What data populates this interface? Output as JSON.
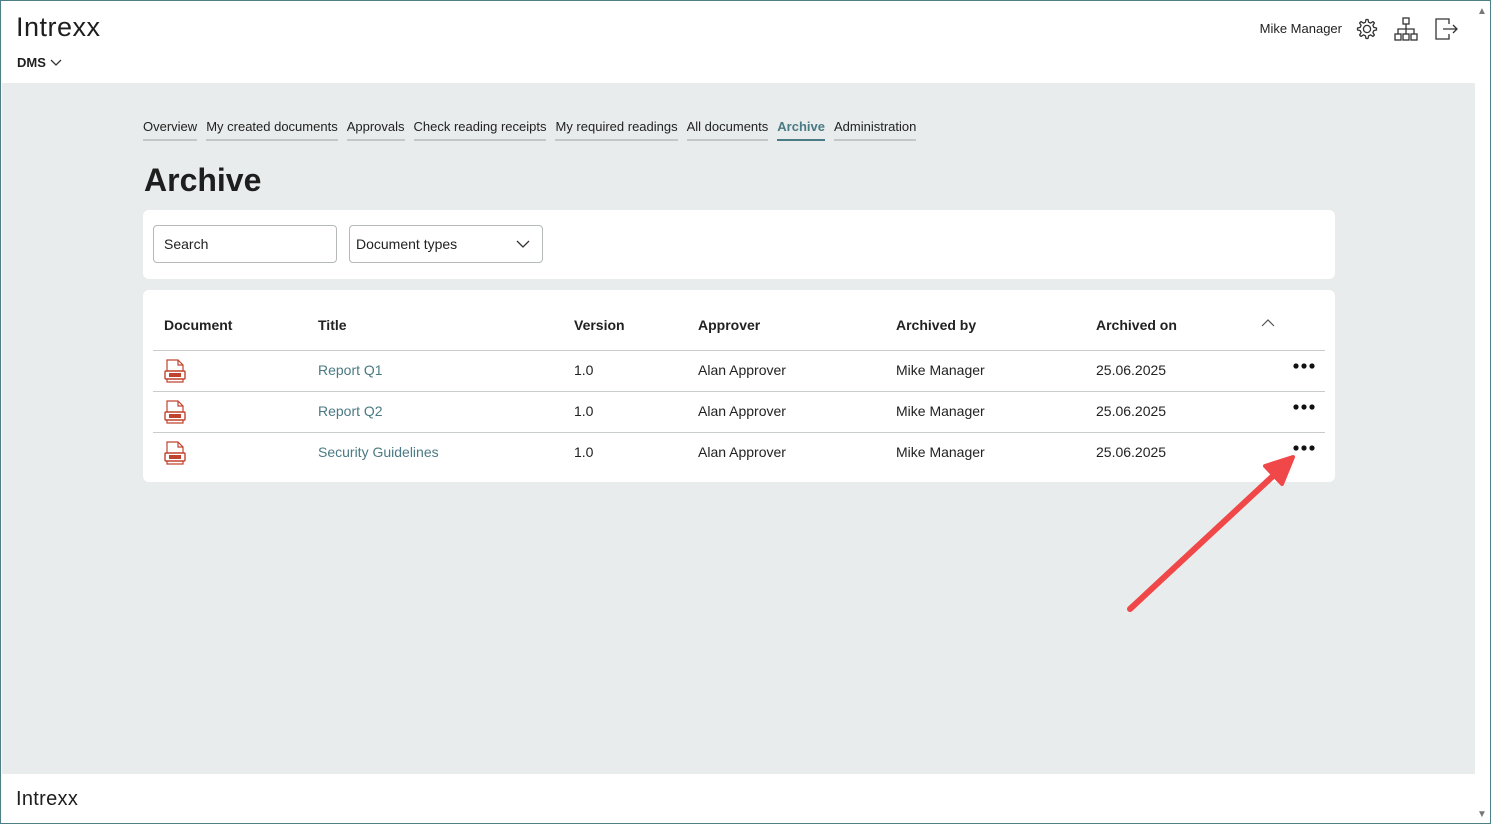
{
  "header": {
    "logo": "Intrexx",
    "module": "DMS",
    "user": "Mike Manager"
  },
  "tabs": [
    {
      "label": "Overview"
    },
    {
      "label": "My created documents"
    },
    {
      "label": "Approvals"
    },
    {
      "label": "Check reading receipts"
    },
    {
      "label": "My required readings"
    },
    {
      "label": "All documents"
    },
    {
      "label": "Archive",
      "active": true
    },
    {
      "label": "Administration"
    }
  ],
  "page_title": "Archive",
  "filters": {
    "search_placeholder": "Search",
    "document_types": "Document types"
  },
  "table": {
    "headers": {
      "document": "Document",
      "title": "Title",
      "version": "Version",
      "approver": "Approver",
      "archived_by": "Archived by",
      "archived_on": "Archived on"
    },
    "rows": [
      {
        "title": "Report Q1",
        "version": "1.0",
        "approver": "Alan Approver",
        "archived_by": "Mike Manager",
        "archived_on": "25.06.2025"
      },
      {
        "title": "Report Q2",
        "version": "1.0",
        "approver": "Alan Approver",
        "archived_by": "Mike Manager",
        "archived_on": "25.06.2025"
      },
      {
        "title": "Security Guidelines",
        "version": "1.0",
        "approver": "Alan Approver",
        "archived_by": "Mike Manager",
        "archived_on": "25.06.2025"
      }
    ]
  },
  "footer": {
    "logo": "Intrexx"
  },
  "colors": {
    "accent": "#4a7a83",
    "background": "#e9ecec",
    "annotation_arrow": "#f04848",
    "doc_icon": "#c0432e"
  },
  "icons": [
    "chevron-down-icon",
    "gear-icon",
    "sitemap-icon",
    "logout-icon",
    "document-icon",
    "more-options-icon",
    "sort-up-icon"
  ]
}
